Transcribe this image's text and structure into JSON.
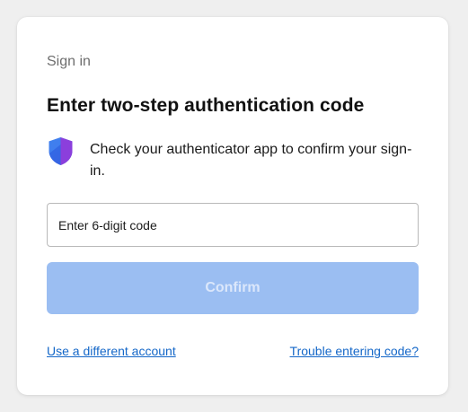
{
  "colors": {
    "background": "#efefef",
    "card": "#ffffff",
    "button_disabled": "#9bbef2",
    "link": "#1467c8",
    "shield_blue": "#2f6ee8",
    "shield_purple": "#8b3fdc"
  },
  "header": {
    "eyebrow": "Sign in",
    "title": "Enter two-step authentication code"
  },
  "info": {
    "icon": "shield-icon",
    "text": "Check your authenticator app to confirm your sign-in."
  },
  "form": {
    "code_placeholder": "Enter 6-digit code",
    "code_value": "",
    "confirm_label": "Confirm",
    "confirm_state": "disabled"
  },
  "links": {
    "different_account": "Use a different account",
    "trouble": "Trouble entering code?"
  }
}
